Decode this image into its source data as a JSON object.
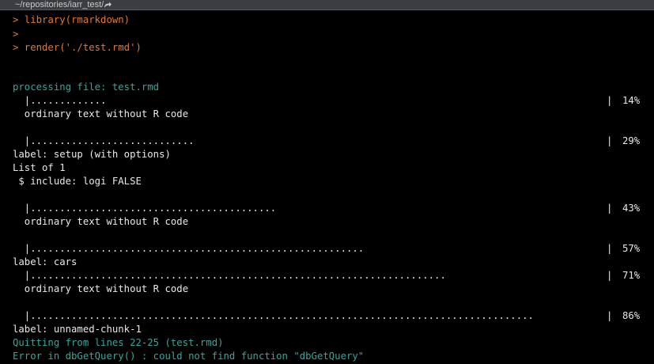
{
  "pathbar": {
    "path": "~/repositories/iarr_test/",
    "icon": "share-arrow-icon"
  },
  "colors": {
    "background": "#000000",
    "prompt": "#e07a2e",
    "message": "#32a89c",
    "text": "#e8e8e8"
  },
  "console": {
    "cmd1": "> library(rmarkdown)",
    "cmd2": ">",
    "cmd3": "> render('./test.rmd')",
    "processing": "processing file: test.rmd",
    "bar14": "  |.............",
    "pct14": "14%",
    "ordinary1": "  ordinary text without R code",
    "bar29": "  |............................",
    "pct29": "29%",
    "label_setup": "label: setup (with options)",
    "list_of": "List of 1",
    "include": " $ include: logi FALSE",
    "bar43": "  |..........................................",
    "pct43": "43%",
    "ordinary2": "  ordinary text without R code",
    "bar57": "  |.........................................................",
    "pct57": "57%",
    "label_cars": "label: cars",
    "bar71": "  |.......................................................................",
    "pct71": "71%",
    "ordinary3": "  ordinary text without R code",
    "bar86": "  |......................................................................................",
    "pct86": "86%",
    "label_chunk": "label: unnamed-chunk-1",
    "quitting": "Quitting from lines 22-25 (test.rmd)",
    "error": "Error in dbGetQuery() : could not find function \"dbGetQuery\""
  }
}
